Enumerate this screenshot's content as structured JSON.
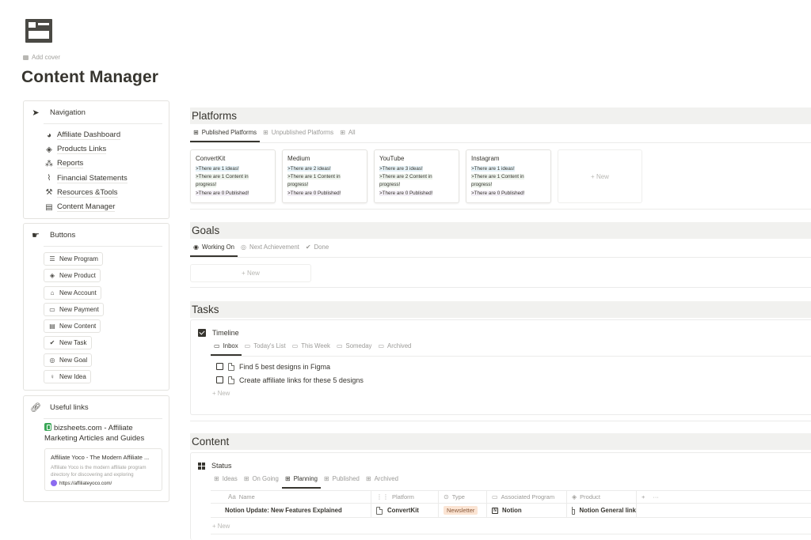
{
  "page": {
    "title": "Content Manager",
    "add_cover_label": "Add cover",
    "icon": "content-manager-icon"
  },
  "sidebar": {
    "navigation": {
      "title": "Navigation",
      "icon": "navigation-arrow-icon",
      "items": [
        {
          "label": "Affiliate Dashboard",
          "icon": "dashboard-icon"
        },
        {
          "label": "Products Links",
          "icon": "products-icon"
        },
        {
          "label": "Reports",
          "icon": "reports-icon"
        },
        {
          "label": "Financial Statements",
          "icon": "chart-icon"
        },
        {
          "label": "Resources &Tools",
          "icon": "tools-icon"
        },
        {
          "label": "Content Manager",
          "icon": "content-icon"
        }
      ]
    },
    "buttons": {
      "title": "Buttons",
      "icon": "button-click-icon",
      "items": [
        {
          "label": "New Program",
          "icon": "database-icon"
        },
        {
          "label": "New Product",
          "icon": "box-icon"
        },
        {
          "label": "New Account",
          "icon": "bank-icon"
        },
        {
          "label": "New Payment",
          "icon": "money-icon"
        },
        {
          "label": "New Content",
          "icon": "layout-icon"
        },
        {
          "label": "New Task",
          "icon": "check-circle-icon"
        },
        {
          "label": "New Goal",
          "icon": "target-icon"
        },
        {
          "label": "New Idea",
          "icon": "lightbulb-icon"
        }
      ]
    },
    "useful_links": {
      "title": "Useful links",
      "icon": "link-icon",
      "bizsheets_link": "bizsheets.com - Affiliate Marketing Articles and Guides",
      "preview": {
        "title": "Affiliate Yoco - The Modern Affiliate ...",
        "description": "Affiliate Yoco is the modern affiliate program directory for discovering and exploring",
        "url": "https://affiliateyoco.com/"
      }
    }
  },
  "platforms": {
    "title": "Platforms",
    "tabs": [
      {
        "label": "Published Platforms",
        "active": true
      },
      {
        "label": "Unpublished Platforms",
        "active": false
      },
      {
        "label": "All",
        "active": false
      }
    ],
    "cards": [
      {
        "name": "ConvertKit",
        "ideas": ">There are 1 ideas!",
        "progress": ">There are 1 Content in progress!",
        "published": ">There are 0 Published!"
      },
      {
        "name": "Medium",
        "ideas": ">There are 2 ideas!",
        "progress": ">There are 1 Content in progress!",
        "published": ">There are 0 Published!"
      },
      {
        "name": "YouTube",
        "ideas": ">There are 3 ideas!",
        "progress": ">There are 2 Content in progress!",
        "published": ">There are 0 Published!"
      },
      {
        "name": "Instagram",
        "ideas": ">There are 1 ideas!",
        "progress": ">There are 1 Content in progress!",
        "published": ">There are 0 Published!"
      }
    ],
    "new_label": "+ New"
  },
  "goals": {
    "title": "Goals",
    "tabs": [
      {
        "label": "Working On",
        "active": true
      },
      {
        "label": "Next Achievement",
        "active": false
      },
      {
        "label": "Done",
        "active": false
      }
    ],
    "new_label": "+ New"
  },
  "tasks": {
    "title": "Tasks",
    "view_title": "Timeline",
    "tabs": [
      {
        "label": "Inbox",
        "active": true
      },
      {
        "label": "Today's List",
        "active": false
      },
      {
        "label": "This Week",
        "active": false
      },
      {
        "label": "Someday",
        "active": false
      },
      {
        "label": "Archived",
        "active": false
      }
    ],
    "items": [
      {
        "label": "Find 5 best designs in Figma",
        "checked": false
      },
      {
        "label": "Create affiliate links for these 5 designs",
        "checked": false
      }
    ],
    "new_label": "+ New"
  },
  "content": {
    "title": "Content",
    "view_title": "Status",
    "tabs": [
      {
        "label": "Ideas",
        "active": false
      },
      {
        "label": "On Going",
        "active": false
      },
      {
        "label": "Planning",
        "active": true
      },
      {
        "label": "Published",
        "active": false
      },
      {
        "label": "Archived",
        "active": false
      }
    ],
    "columns": [
      {
        "label": "Name",
        "icon": "Aa"
      },
      {
        "label": "Platform",
        "icon": "relation-icon"
      },
      {
        "label": "Type",
        "icon": "select-icon"
      },
      {
        "label": "Associated Program",
        "icon": "relation-icon"
      },
      {
        "label": "Product",
        "icon": "relation-icon"
      }
    ],
    "rows": [
      {
        "name": "Notion Update: New Features Explained",
        "platform": "ConvertKit",
        "type": "Newsletter",
        "program": "Notion",
        "product": "Notion General link"
      }
    ],
    "add_column": "+",
    "more": "···",
    "new_label": "+ New"
  },
  "colors": {
    "text": "#37352f",
    "muted": "#9b9a97",
    "section_bg": "#f1f1ef",
    "highlight_ideas": "#e7f3f8",
    "highlight_progress": "#edf3ec",
    "highlight_published": "#f4f0f7",
    "tag_newsletter": "#fbe4d3"
  }
}
